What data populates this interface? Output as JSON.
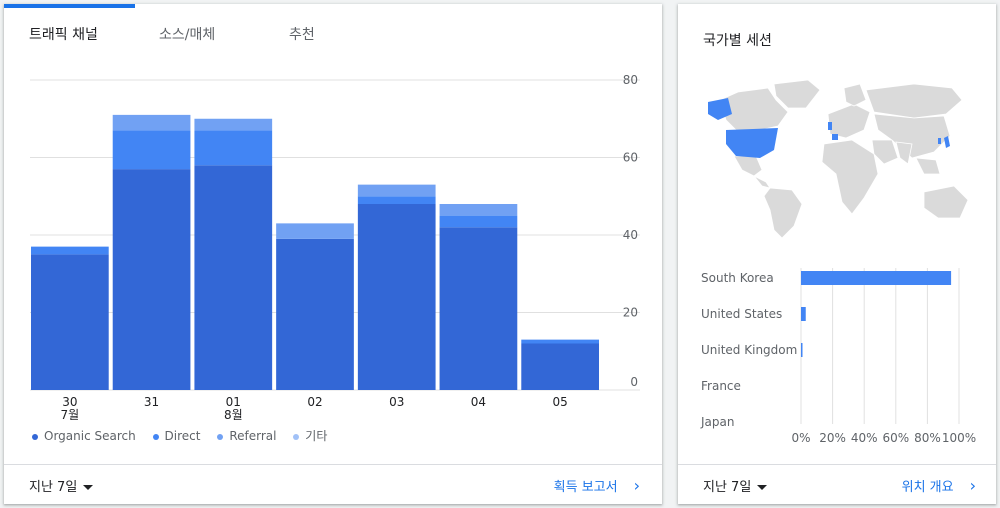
{
  "left_card": {
    "tabs": [
      {
        "label": "트래픽 채널",
        "active": true
      },
      {
        "label": "소스/매체",
        "active": false
      },
      {
        "label": "추천",
        "active": false
      }
    ],
    "footer": {
      "range_label": "지난 7일",
      "link_label": "획득 보고서"
    }
  },
  "right_card": {
    "title": "국가별 세션",
    "footer": {
      "range_label": "지난 7일",
      "link_label": "위치 개요"
    }
  },
  "colors": {
    "organic": "#3367d6",
    "direct": "#4285f4",
    "referral": "#71a1f3",
    "other": "#a1c1f7",
    "accent": "#1a73e8",
    "map_land": "#dadada",
    "map_highlight": "#4285f4"
  },
  "chart_data": [
    {
      "type": "bar",
      "stacked": true,
      "categories": [
        "30",
        "31",
        "01",
        "02",
        "03",
        "04",
        "05"
      ],
      "category_sublabels": [
        "7월",
        "",
        "8월",
        "",
        "",
        "",
        ""
      ],
      "series": [
        {
          "name": "Organic Search",
          "values": [
            35,
            57,
            58,
            39,
            48,
            42,
            12
          ]
        },
        {
          "name": "Direct",
          "values": [
            2,
            10,
            9,
            0,
            2,
            3,
            1
          ]
        },
        {
          "name": "Referral",
          "values": [
            0,
            4,
            3,
            4,
            3,
            3,
            0
          ]
        },
        {
          "name": "기타",
          "values": [
            0,
            0,
            0,
            0,
            0,
            0,
            0
          ]
        }
      ],
      "ylim": [
        0,
        80
      ],
      "yticks": [
        0,
        20,
        40,
        60,
        80
      ],
      "grid": true,
      "legend_position": "bottom"
    },
    {
      "type": "bar",
      "orientation": "horizontal",
      "categories": [
        "South Korea",
        "United States",
        "United Kingdom",
        "France",
        "Japan"
      ],
      "values": [
        95,
        3,
        0.5,
        0,
        0
      ],
      "xlim": [
        0,
        100
      ],
      "xticks": [
        "0%",
        "20%",
        "40%",
        "60%",
        "80%",
        "100%"
      ],
      "grid": true
    }
  ]
}
